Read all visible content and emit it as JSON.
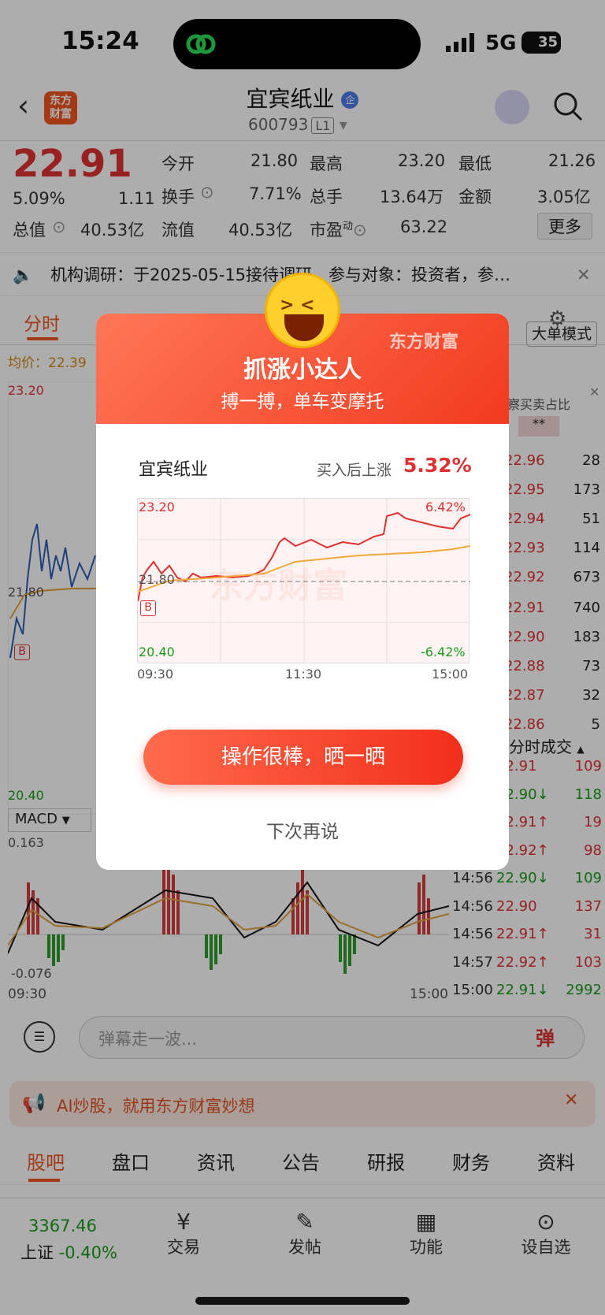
{
  "status": {
    "time": "15:24",
    "network": "5G",
    "battery": "35"
  },
  "header": {
    "back_icon": "chevron-left-icon",
    "logo_text": "东方\n财富",
    "stock_name": "宜宾纸业",
    "badge": "企",
    "stock_code": "600793",
    "level": "L1"
  },
  "quote": {
    "price": "22.91",
    "pct": "5.09%",
    "change": "1.11",
    "open_label": "今开",
    "open": "21.80",
    "high_label": "最高",
    "high": "23.20",
    "low_label": "最低",
    "low": "21.26",
    "turnover_label": "换手",
    "turnover": "7.71%",
    "volume_label": "总手",
    "volume": "13.64万",
    "amount_label": "金额",
    "amount": "3.05亿",
    "mcap_label": "总值",
    "mcap": "40.53亿",
    "float_label": "流值",
    "float": "40.53亿",
    "pe_label": "市盈",
    "pe_sup": "动",
    "pe": "63.22",
    "more": "更多"
  },
  "notice": {
    "text": "机构调研：于2025-05-15接待调研，参与对象：投资者，参…"
  },
  "chart_tabs": {
    "active": "分时",
    "mode": "大单模式"
  },
  "left_chart": {
    "avg_label": "均价：22.39",
    "top": "23.20",
    "mid": "21.80",
    "bottom": "20.40",
    "macd": "MACD",
    "macd_top": "0.163",
    "macd_bottom": "-0.076",
    "t_start": "09:30",
    "t_end": "15:00"
  },
  "order_book": {
    "header": "洞察买卖占比",
    "stars": "**",
    "asks": [
      [
        "22.96",
        "28"
      ],
      [
        "22.95",
        "173"
      ],
      [
        "22.94",
        "51"
      ],
      [
        "22.93",
        "114"
      ],
      [
        "22.92",
        "673"
      ]
    ],
    "bids": [
      [
        "22.91",
        "740"
      ],
      [
        "22.90",
        "183"
      ],
      [
        "22.88",
        "73"
      ],
      [
        "22.87",
        "32"
      ],
      [
        "22.86",
        "5"
      ]
    ],
    "ticks_title": "分时成交",
    "ticks": [
      [
        "",
        "22.91",
        "109",
        "r"
      ],
      [
        "",
        "22.90↓",
        "118",
        "g"
      ],
      [
        "",
        "22.91↑",
        "19",
        "r"
      ],
      [
        "",
        "22.92↑",
        "98",
        "r"
      ],
      [
        "14:56",
        "22.90↓",
        "109",
        "g"
      ],
      [
        "14:56",
        "22.90",
        "137",
        "r"
      ],
      [
        "14:56",
        "22.91↑",
        "31",
        "r"
      ],
      [
        "14:57",
        "22.92↑",
        "103",
        "r"
      ],
      [
        "15:00",
        "22.91↓",
        "2992",
        "g"
      ]
    ]
  },
  "danmu": {
    "placeholder": "弹幕走一波...",
    "btn": "弹"
  },
  "ad": {
    "text": "AI炒股，就用东方财富妙想"
  },
  "sub_tabs": [
    "股吧",
    "盘口",
    "资讯",
    "公告",
    "研报",
    "财务",
    "资料"
  ],
  "bottom_nav": {
    "index_value": "3367.46",
    "index_name": "上证",
    "index_pct": "-0.40%",
    "trade": "交易",
    "post": "发帖",
    "features": "功能",
    "watch": "设自选"
  },
  "modal": {
    "brand": "东方财富",
    "title": "抓涨小达人",
    "subtitle": "搏一搏，单车变摩托",
    "stock": "宜宾纸业",
    "gain_label": "买入后上涨",
    "gain": "5.32%",
    "y_top": "23.20",
    "y_bottom": "20.40",
    "pct_top": "6.42%",
    "pct_bottom": "-6.42%",
    "y_mid": "21.80",
    "x_labels": [
      "09:30",
      "11:30",
      "15:00"
    ],
    "buy_marker": "B",
    "watermark": "东方财富",
    "share_button": "操作很棒，晒一晒",
    "later": "下次再说"
  },
  "colors": {
    "up": "#e03131",
    "down": "#1a9c1a",
    "accent": "#f0561f"
  }
}
